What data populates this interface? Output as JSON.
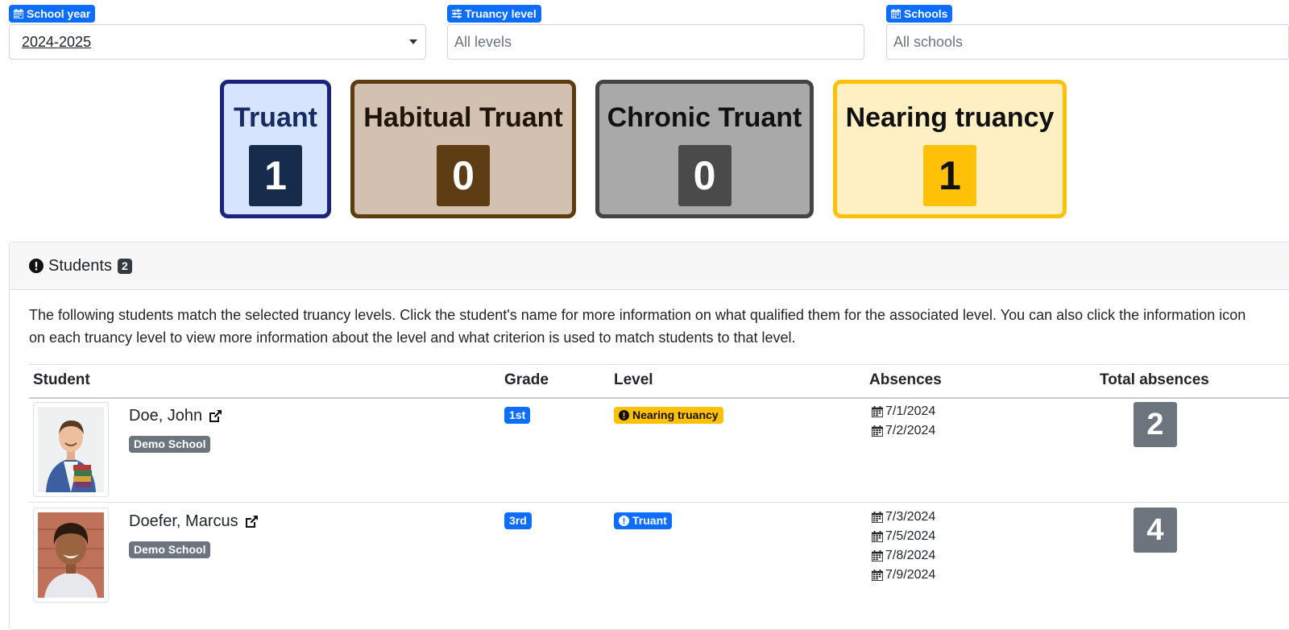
{
  "filters": {
    "school_year": {
      "label": "School year",
      "value": "2024-2025"
    },
    "truancy_level": {
      "label": "Truancy level",
      "placeholder": "All levels"
    },
    "schools": {
      "label": "Schools",
      "placeholder": "All schools"
    }
  },
  "summary_cards": [
    {
      "title": "Truant",
      "count": "1",
      "colors": {
        "bg": "#d6e4fd",
        "border": "#1a237e",
        "text": "#172b64",
        "num_bg": "#172b4d"
      }
    },
    {
      "title": "Habitual Truant",
      "count": "0",
      "colors": {
        "bg": "#d2c0b0",
        "border": "#5c3d10",
        "text": "#1f140a",
        "num_bg": "#5e3d14"
      }
    },
    {
      "title": "Chronic Truant",
      "count": "0",
      "colors": {
        "bg": "#a9a9a9",
        "border": "#444444",
        "text": "#111111",
        "num_bg": "#4a4a4a"
      }
    },
    {
      "title": "Nearing truancy",
      "count": "1",
      "colors": {
        "bg": "#fff0c4",
        "border": "#ffc107",
        "text": "#111111",
        "num_bg": "#ffc107"
      }
    }
  ],
  "students_panel": {
    "title": "Students",
    "count": "2",
    "description": "The following students match the selected truancy levels. Click the student's name for more information on what qualified them for the associated level. You can also click the information icon on each truancy level to view more information about the level and what criterion is used to match students to that level.",
    "columns": {
      "student": "Student",
      "grade": "Grade",
      "level": "Level",
      "absences": "Absences",
      "total": "Total absences"
    },
    "rows": [
      {
        "name": "Doe, John",
        "school": "Demo School",
        "grade": "1st",
        "level": "Nearing truancy",
        "level_color": "#ffc107",
        "absences": [
          "7/1/2024",
          "7/2/2024"
        ],
        "total": "2"
      },
      {
        "name": "Doefer, Marcus",
        "school": "Demo School",
        "grade": "3rd",
        "level": "Truant",
        "level_color": "#0d6efd",
        "absences": [
          "7/3/2024",
          "7/5/2024",
          "7/8/2024",
          "7/9/2024"
        ],
        "total": "4"
      }
    ]
  }
}
